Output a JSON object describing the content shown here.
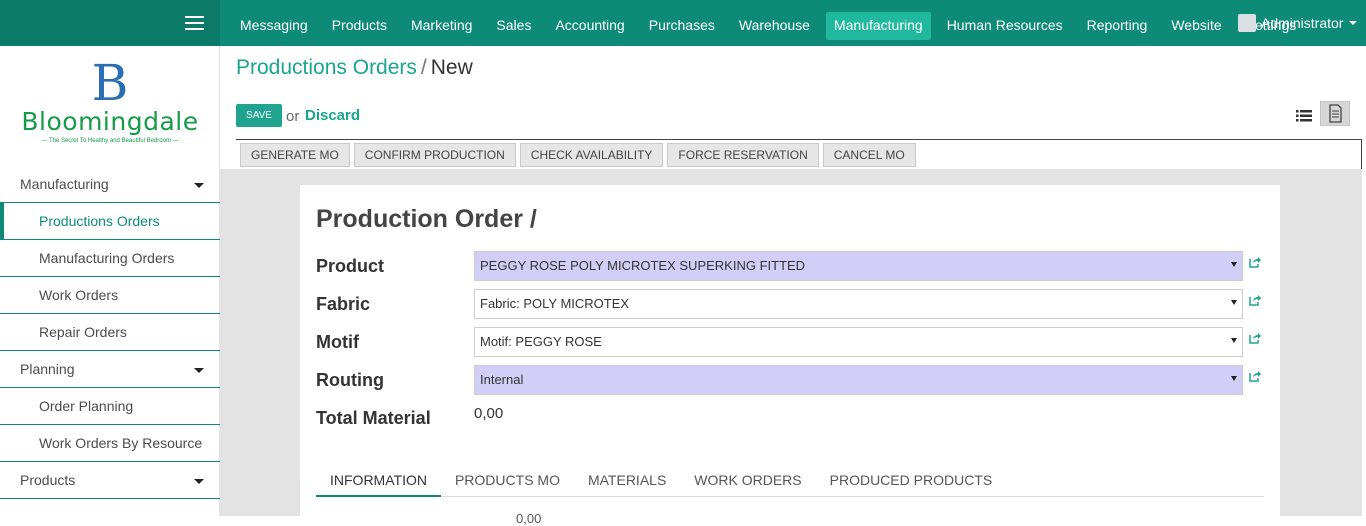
{
  "topbar": {
    "menu": [
      "Messaging",
      "Products",
      "Marketing",
      "Sales",
      "Accounting",
      "Purchases",
      "Warehouse",
      "Manufacturing",
      "Human Resources",
      "Reporting",
      "Website",
      "Settings"
    ],
    "active": "Manufacturing",
    "user": "Administrator"
  },
  "logo": {
    "letter": "B",
    "name": "Bloomingdale",
    "tagline": "— The Secret To Healthy and Beautiful Bedroom —"
  },
  "sidebar": {
    "sections": [
      {
        "label": "Manufacturing",
        "items": [
          "Productions Orders",
          "Manufacturing Orders",
          "Work Orders",
          "Repair Orders"
        ]
      },
      {
        "label": "Planning",
        "items": [
          "Order Planning",
          "Work Orders By Resource"
        ]
      },
      {
        "label": "Products",
        "items": []
      }
    ],
    "active_item": "Productions Orders"
  },
  "breadcrumb": {
    "parent": "Productions Orders",
    "separator": "/",
    "current": "New"
  },
  "actions": {
    "save": "SAVE",
    "or": "or",
    "discard": "Discard"
  },
  "status_buttons": [
    "GENERATE MO",
    "CONFIRM PRODUCTION",
    "CHECK AVAILABILITY",
    "FORCE RESERVATION",
    "CANCEL MO"
  ],
  "form": {
    "title": "Production Order /",
    "product": {
      "label": "Product",
      "value": "PEGGY ROSE POLY MICROTEX SUPERKING FITTED"
    },
    "fabric": {
      "label": "Fabric",
      "value": "Fabric: POLY MICROTEX"
    },
    "motif": {
      "label": "Motif",
      "value": "Motif: PEGGY ROSE"
    },
    "routing": {
      "label": "Routing",
      "value": "Internal"
    },
    "total_material": {
      "label": "Total Material",
      "value": "0,00"
    }
  },
  "tabs": [
    "INFORMATION",
    "PRODUCTS MO",
    "MATERIALS",
    "WORK ORDERS",
    "PRODUCED PRODUCTS"
  ],
  "tail_value": "0,00",
  "colors": {
    "primary": "#0e8b78",
    "accent": "#1fa58f",
    "required_field": "#d1cff7"
  }
}
